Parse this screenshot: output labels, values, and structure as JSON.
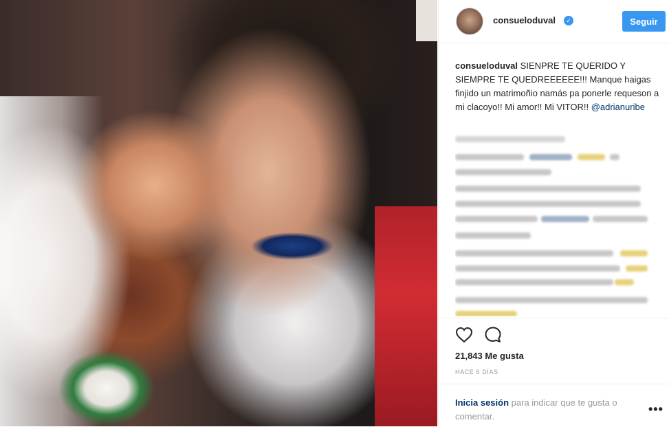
{
  "post": {
    "username": "consueloduval",
    "verified_icon": "verified-badge-icon",
    "follow_label": "Seguir",
    "caption_user": "consueloduval",
    "caption_text": "SIENPRE TE QUERIDO Y SIEMPRE TE QUEDREEEEEE!!! Manque haigas finjido un matrimoñio namás pa ponerle requeson a mi clacoyo!! Mi amor!! Mi VITOR!! ",
    "caption_mention": "@adrianuribe",
    "likes": "21,843 Me gusta",
    "time": "HACE 6 DÍAS",
    "login_link": "Inicia sesión",
    "login_text": " para indicar que te gusta o comentar.",
    "more_label": "•••"
  },
  "icons": {
    "like": "heart-icon",
    "comment": "comment-icon",
    "more": "more-options-icon"
  },
  "colors": {
    "accent": "#3897f0",
    "link": "#003569",
    "muted": "#999999",
    "text": "#262626"
  }
}
